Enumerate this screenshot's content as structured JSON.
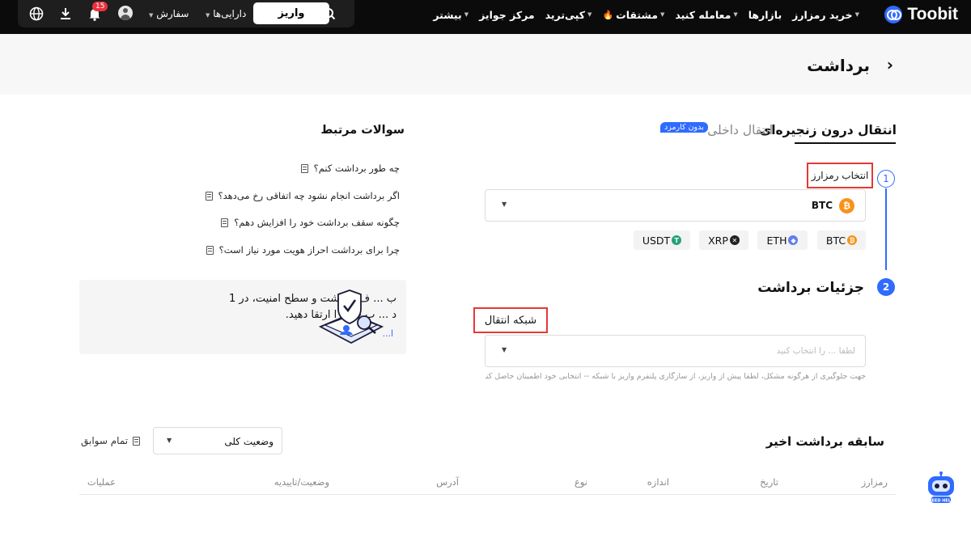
{
  "brand": {
    "name": "Toobit"
  },
  "nav": {
    "items": [
      {
        "label": "خرید رمزارز",
        "caret": true
      },
      {
        "label": "بازارها",
        "caret": false
      },
      {
        "label": "معامله کنید",
        "caret": true
      },
      {
        "label": "مشتقات",
        "caret": true,
        "hot": true
      },
      {
        "label": "کپی‌ترید",
        "caret": true
      },
      {
        "label": "مرکز جوایز",
        "caret": false
      },
      {
        "label": "بیشتر",
        "caret": true
      }
    ]
  },
  "toolbar": {
    "deposit_label": "واریز",
    "assets_label": "دارایی‌ها",
    "orders_label": "سفارش",
    "notification_count": "15"
  },
  "page": {
    "title": "برداشت"
  },
  "tabs": {
    "onchain": "انتقال درون زنجیره‌ای",
    "internal": "انتقال داخلی",
    "internal_badge": "بدون کارمزد"
  },
  "steps": {
    "one": "1",
    "two": "2",
    "select_coin_label": "انتخاب رمزارز",
    "coin_value": "BTC",
    "chips": [
      "BTC",
      "ETH",
      "XRP",
      "USDT"
    ],
    "details_title": "جزئیات برداشت",
    "network_label": "شبکه انتقال",
    "network_placeholder": "لطفا ... را انتخاب کنید",
    "network_hint": "جهت جلوگیری از هرگونه مشکل، لطفا پیش از واریز، از سازگاری پلتفرم واریز با شبکه -- انتخابی خود اطمینان حاصل کنید."
  },
  "faq": {
    "title": "سوالات مرتبط",
    "items": [
      "چه طور برداشت کنم؟",
      "اگر برداشت انجام نشود چه اتفاقی رخ می‌دهد؟",
      "چگونه سقف برداشت خود را افزایش دهم؟",
      "چرا برای برداشت احراز هویت مورد نیاز است؟"
    ]
  },
  "promo": {
    "line1": "ب ... ف برداشت و سطح امنیت، در 1",
    "line2": "د ... ب خود را ارتقا دهید.",
    "link": "ا..."
  },
  "history": {
    "title": "سابقه برداشت اخیر",
    "status_filter": "وضعیت کلی",
    "all_records": "تمام سوابق",
    "columns": {
      "coin": "رمزارز",
      "date": "تاریخ",
      "amount": "اندازه",
      "type": "نوع",
      "address": "آدرس",
      "status": "وضعیت/تاییدیه",
      "actions": "عملیات"
    }
  },
  "help_bot": {
    "label": "NEED HELP"
  },
  "icons": {
    "globe": "globe-icon",
    "download": "download-icon",
    "bell": "bell-icon",
    "search": "search-icon",
    "back": "chevron-right-icon",
    "doc": "document-icon"
  },
  "colors": {
    "accent": "#2f6bff",
    "highlight": "#e53935",
    "topbar": "#0b0b0b",
    "btc": "#f7931a"
  }
}
